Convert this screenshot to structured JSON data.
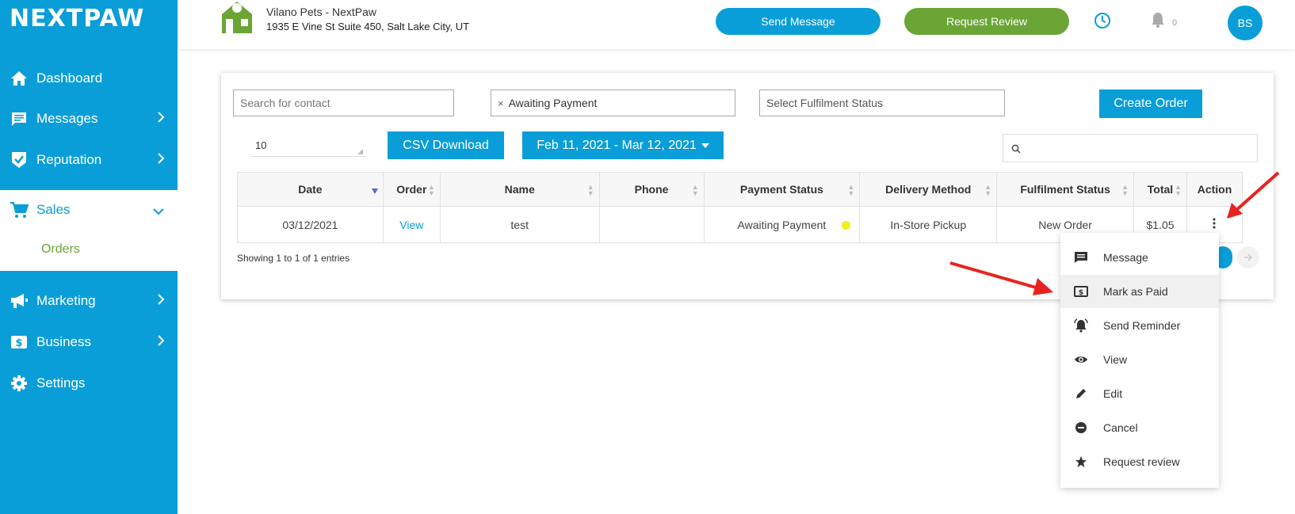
{
  "brand": {
    "logo_text": "NEXTPAW"
  },
  "sidebar": {
    "items": [
      {
        "label": "Dashboard",
        "icon": "home-icon"
      },
      {
        "label": "Messages",
        "icon": "message-icon"
      },
      {
        "label": "Reputation",
        "icon": "shield-check-icon"
      },
      {
        "label": "Sales",
        "icon": "cart-icon"
      },
      {
        "label": "Marketing",
        "icon": "megaphone-icon"
      },
      {
        "label": "Business",
        "icon": "dollar-icon"
      },
      {
        "label": "Settings",
        "icon": "gear-icon"
      }
    ],
    "sub_item": "Orders"
  },
  "header": {
    "business_name": "Vilano Pets - NextPaw",
    "business_address": "1935 E Vine St Suite 450, Salt Lake City, UT",
    "send_message": "Send Message",
    "request_review": "Request Review",
    "notification_count": "0",
    "avatar_initials": "BS"
  },
  "filters": {
    "search_placeholder": "Search for contact",
    "payment_tag": "Awaiting Payment",
    "fulfilment_placeholder": "Select Fulfilment Status",
    "create_order": "Create Order",
    "page_size": "10",
    "csv_download": "CSV Download",
    "date_range": "Feb 11, 2021 - Mar 12, 2021"
  },
  "table": {
    "headers": [
      "Date",
      "Order",
      "Name",
      "Phone",
      "Payment Status",
      "Delivery Method",
      "Fulfilment Status",
      "Total",
      "Action"
    ],
    "row": {
      "date": "03/12/2021",
      "order": "View",
      "name": "test",
      "phone": "",
      "payment_status": "Awaiting Payment",
      "delivery": "In-Store Pickup",
      "fulfilment": "New Order",
      "total": "$1.05"
    },
    "showing": "Showing 1 to 1 of 1 entries"
  },
  "action_menu": {
    "items": [
      "Message",
      "Mark as Paid",
      "Send Reminder",
      "View",
      "Edit",
      "Cancel",
      "Request review"
    ],
    "highlighted": "Mark as Paid"
  },
  "colors": {
    "primary": "#0a9ed8",
    "green": "#6aa535",
    "status_dot": "#f2ef1e",
    "annotation": "#e8231f"
  }
}
